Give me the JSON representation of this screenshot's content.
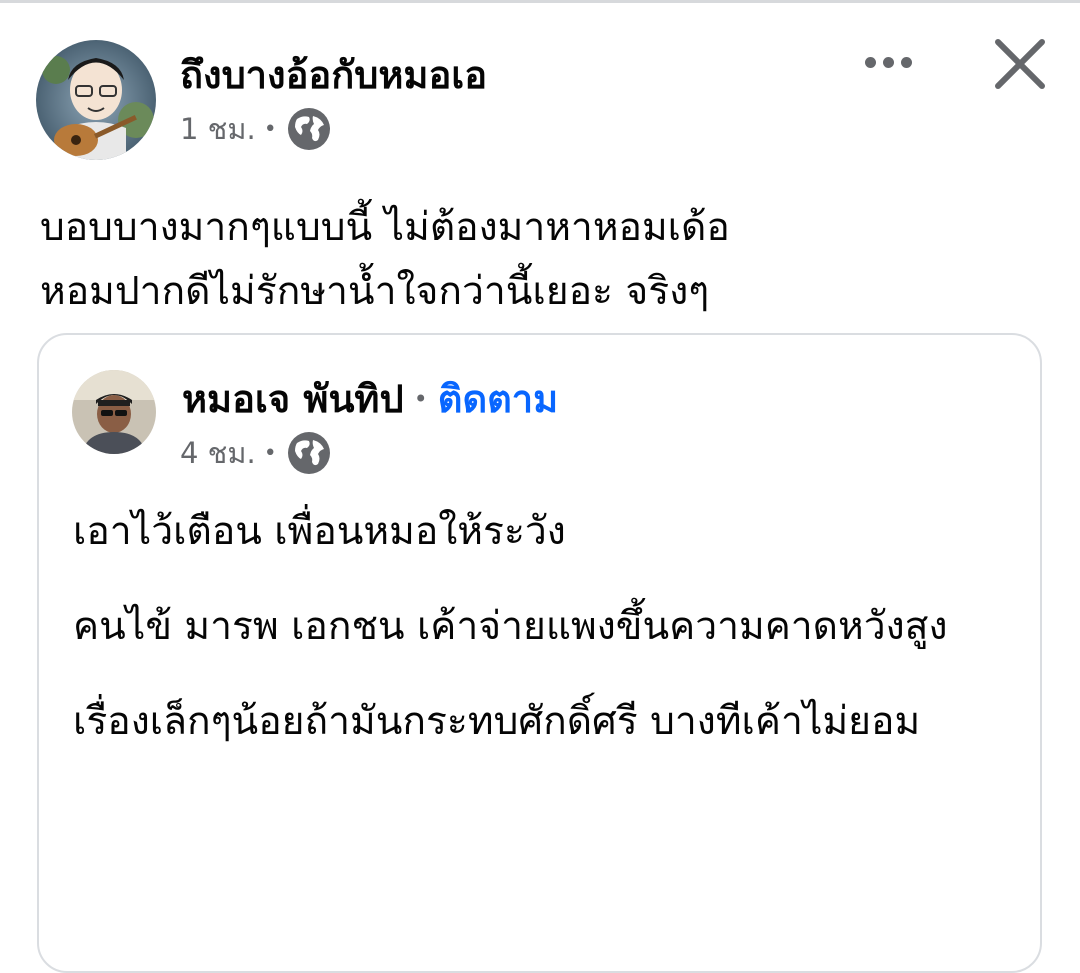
{
  "post": {
    "author": "ถึงบางอ้อกับหมอเอ",
    "time": "1 ชม.",
    "separator": "•",
    "privacy_icon": "globe-icon",
    "text_lines": [
      "บอบบางมากๆแบบนี้ ไม่ต้องมาหาหอมเด้อ",
      "หอมปากดีไม่รักษาน้ำใจกว่านี้เยอะ จริงๆ"
    ]
  },
  "header_actions": {
    "more_icon": "more-options-icon",
    "close_icon": "close-icon"
  },
  "shared_post": {
    "author": "หมอเจ พันทิป",
    "separator": "•",
    "follow_label": "ติดตาม",
    "time": "4 ชม.",
    "privacy_icon": "globe-icon",
    "paragraphs": [
      "เอาไว้เตือน เพื่อนหมอให้ระวัง",
      "คนไข้ มารพ เอกชน เค้าจ่ายแพงขึ้นความคาดหวังสูง",
      "เรื่องเล็กๆน้อยถ้ามันกระทบศักดิ์ศรี บางทีเค้าไม่ยอม"
    ]
  },
  "colors": {
    "link_blue": "#0866ff",
    "secondary_text": "#65676b",
    "card_border": "#dadde1"
  }
}
